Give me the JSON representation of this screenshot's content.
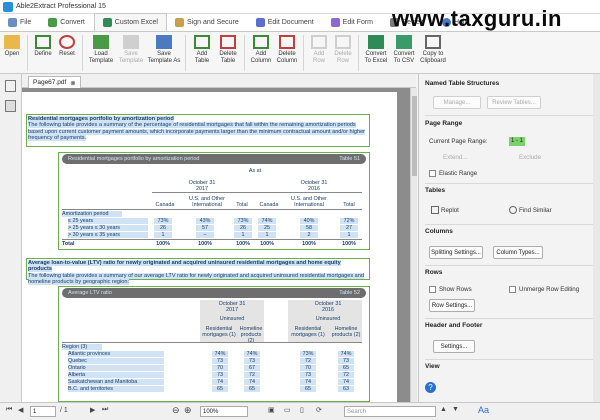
{
  "app": {
    "title": "Able2Extract Professional 15"
  },
  "watermark": "www.taxguru.in",
  "tabs": [
    {
      "label": "File",
      "color": "#6b8fc4"
    },
    {
      "label": "Convert",
      "color": "#4a9a4a"
    },
    {
      "label": "Custom Excel",
      "color": "#2e8b57"
    },
    {
      "label": "Sign and Secure",
      "color": "#c8a04a"
    },
    {
      "label": "Edit Document",
      "color": "#5a6fd0"
    },
    {
      "label": "Edit Form",
      "color": "#8a6ad0"
    },
    {
      "label": "Review",
      "color": "#7a7a7a"
    },
    {
      "label": "Help",
      "color": "#4a7ac0"
    }
  ],
  "ribbon": {
    "open": "Open",
    "define": "Define",
    "reset": "Reset",
    "load_template": "Load Template",
    "save_template": "Save Template",
    "save_template_as": "Save Template As",
    "add_table": "Add Table",
    "delete_table": "Delete Table",
    "add_column": "Add Column",
    "delete_column": "Delete Column",
    "add_row": "Add Row",
    "delete_row": "Delete Row",
    "convert_excel": "Convert To Excel",
    "convert_csv": "Convert To CSV",
    "copy_clipboard": "Copy to Clipboard"
  },
  "doc_tab": {
    "label": "Page67.pdf",
    "close": "⊗"
  },
  "document": {
    "p1_title": "Residential mortgages portfolio by amortization period",
    "p1_body": "The following table provides a summary of the percentage of residential mortgages that fall within the remaining amortization periods based upon current customer payment amounts, which incorporate payments larger than the minimum contractual amount and/or higher frequency of payments.",
    "t1_title": "Residential mortgages portfolio by amortization period",
    "t1_label": "Table 51",
    "t1_asat": "As at",
    "t1_d1": "October 31",
    "t1_y1": "2017",
    "t1_d2": "October 31",
    "t1_y2": "2016",
    "t1_us1": "U.S. and Other",
    "t1_int1": "International",
    "t1_us2": "U.S. and Other",
    "t1_int2": "International",
    "t1_c1": "Canada",
    "t1_c2": "Total",
    "t1_c3": "Canada",
    "t1_c4": "Total",
    "t1_rowhead": "Amortization period",
    "t1_rows": [
      {
        "label": "≤ 25 years",
        "v": [
          "73%",
          "43%",
          "73%",
          "74%",
          "40%",
          "72%"
        ]
      },
      {
        "label": "> 25 years ≤ 30 years",
        "v": [
          "26",
          "57",
          "26",
          "25",
          "58",
          "27"
        ]
      },
      {
        "label": "> 30 years ≤ 35 years",
        "v": [
          "1",
          "–",
          "1",
          "1",
          "2",
          "1"
        ]
      },
      {
        "label": "Total",
        "v": [
          "100%",
          "100%",
          "100%",
          "100%",
          "100%",
          "100%"
        ]
      }
    ],
    "p2_title": "Average loan-to-value (LTV) ratio for newly originated and acquired uninsured residential mortgages and home equity products",
    "p2_body": "The following table provides a summary of our average LTV ratio for newly originated and acquired uninsured residential mortgages and homeline products by geographic region:",
    "t2_title": "Average LTV ratio",
    "t2_label": "Table 52",
    "t2_d1": "October 31",
    "t2_y1": "2017",
    "t2_d2": "October 31",
    "t2_y2": "2016",
    "t2_u1": "Uninsured",
    "t2_u2": "Uninsured",
    "t2_rm1": "Residential mortgages (1)",
    "t2_hp1": "Homeline products (2)",
    "t2_rm2": "Residential mortgages (1)",
    "t2_hp2": "Homeline products (2)",
    "t2_region": "Region (3)",
    "t2_rows": [
      {
        "label": "Atlantic provinces",
        "v": [
          "74%",
          "74%",
          "73%",
          "74%"
        ]
      },
      {
        "label": "Quebec",
        "v": [
          "73",
          "73",
          "72",
          "73"
        ]
      },
      {
        "label": "Ontario",
        "v": [
          "70",
          "67",
          "70",
          "65"
        ]
      },
      {
        "label": "Alberta",
        "v": [
          "73",
          "72",
          "73",
          "72"
        ]
      },
      {
        "label": "Saskatchewan and Manitoba",
        "v": [
          "74",
          "74",
          "74",
          "74"
        ]
      },
      {
        "label": "B.C. and territories",
        "v": [
          "65",
          "65",
          "65",
          "63"
        ]
      }
    ]
  },
  "panel": {
    "nts": "Named Table Structures",
    "manage": "Manage...",
    "review_tables": "Review Tables...",
    "page_range": "Page Range",
    "current_page_range": "Current Page Range:",
    "range_value": "1 - 1",
    "extend": "Extend...",
    "exclude": "Exclude",
    "elastic_range": "Elastic Range",
    "tables": "Tables",
    "replot": "Replot",
    "find_similar": "Find Similar",
    "columns": "Columns",
    "splitting": "Splitting Settings...",
    "column_types": "Column Types...",
    "rows": "Rows",
    "show_rows": "Show Rows",
    "unmerge": "Unmerge Row Editing",
    "row_settings": "Row Settings...",
    "header_footer": "Header and Footer",
    "hf_settings": "Settings...",
    "view": "View"
  },
  "status": {
    "page_value": "1",
    "page_total": "/ 1",
    "zoom": "100%",
    "search_placeholder": "Search"
  }
}
